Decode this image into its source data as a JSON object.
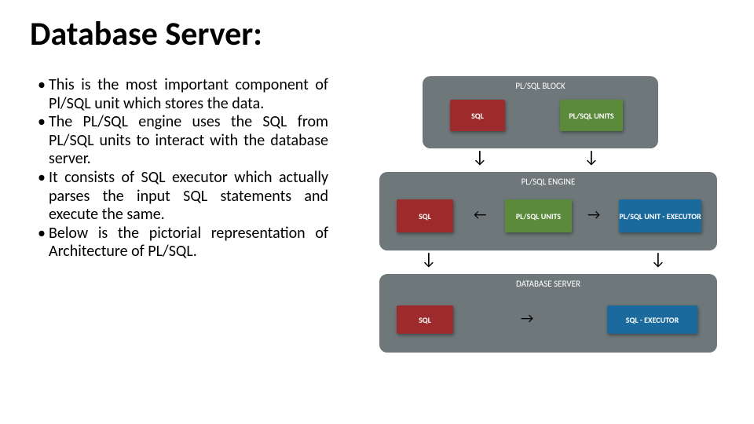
{
  "title": "Database Server:",
  "bullets": [
    "This is the most important component of Pl/SQL unit which stores the data.",
    "The PL/SQL engine uses the SQL from PL/SQL units to interact with the database server.",
    "It consists of SQL executor which actually parses the input SQL statements and execute the same.",
    "Below is the pictorial representation of Architecture of PL/SQL."
  ],
  "diagram": {
    "blocks": [
      {
        "title": "PL/SQL BLOCK",
        "boxes": [
          {
            "label": "SQL",
            "color": "red"
          },
          {
            "label": "PL/SQL UNITS",
            "color": "green"
          }
        ]
      },
      {
        "title": "PL/SQL ENGINE",
        "boxes": [
          {
            "label": "SQL",
            "color": "red"
          },
          {
            "label": "PL/SQL UNITS",
            "color": "green"
          },
          {
            "label": "PL/SQL UNIT - EXECUTOR",
            "color": "blue"
          }
        ]
      },
      {
        "title": "DATABASE SERVER",
        "boxes": [
          {
            "label": "SQL",
            "color": "red"
          },
          {
            "label": "SQL - EXECUTOR",
            "color": "blue"
          }
        ]
      }
    ]
  }
}
